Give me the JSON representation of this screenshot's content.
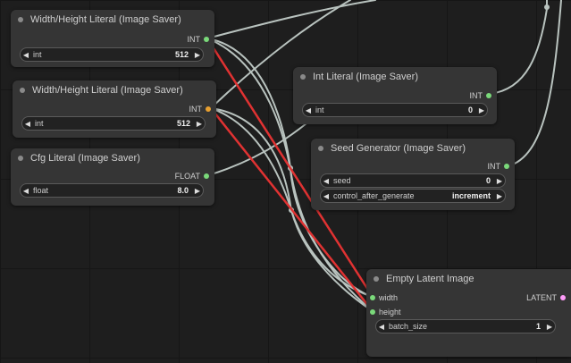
{
  "nodes": {
    "wh1": {
      "title": "Width/Height Literal (Image Saver)",
      "output": "INT",
      "widget": {
        "name": "int",
        "value": "512"
      }
    },
    "wh2": {
      "title": "Width/Height Literal (Image Saver)",
      "output": "INT",
      "widget": {
        "name": "int",
        "value": "512"
      }
    },
    "cfg": {
      "title": "Cfg Literal (Image Saver)",
      "output": "FLOAT",
      "widget": {
        "name": "float",
        "value": "8.0"
      }
    },
    "intlit": {
      "title": "Int Literal (Image Saver)",
      "output": "INT",
      "widget": {
        "name": "int",
        "value": "0"
      }
    },
    "seed": {
      "title": "Seed Generator (Image Saver)",
      "output": "INT",
      "widgets": [
        {
          "name": "seed",
          "value": "0"
        },
        {
          "name": "control_after_generate",
          "value": "increment"
        }
      ]
    },
    "latent": {
      "title": "Empty Latent Image",
      "inputs": [
        "width",
        "height"
      ],
      "output": "LATENT",
      "widget": {
        "name": "batch_size",
        "value": "1"
      }
    }
  },
  "colors": {
    "canvas": "#1e1e1e",
    "node_body": "#353535",
    "link_default": "#b9c3bf",
    "link_selected": "#e03232",
    "int_slot": "#7ad97a",
    "latent_slot": "#ff9cf9"
  }
}
